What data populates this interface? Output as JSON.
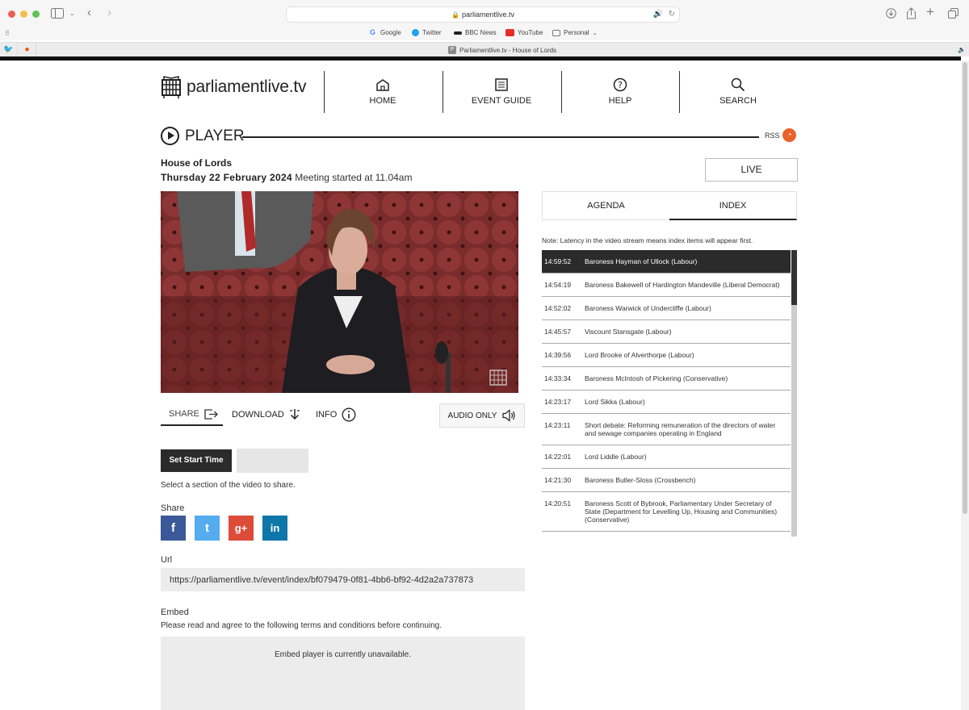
{
  "browser": {
    "url": "parliamentlive.tv",
    "favorites": [
      "Google",
      "Twitter",
      "BBC News",
      "YouTube",
      "Personal"
    ],
    "tab_title": "Parliamentlive.tv - House of Lords",
    "tab_badge": "P"
  },
  "site": {
    "logo": "parliamentlive.tv",
    "nav": [
      "HOME",
      "EVENT GUIDE",
      "HELP",
      "SEARCH"
    ]
  },
  "player": {
    "heading": "PLAYER",
    "rss": "RSS",
    "house": "House of Lords",
    "date": "Thursday 22 February 2024",
    "meeting": "Meeting started at 11.04am",
    "live_button": "LIVE",
    "toolbar": {
      "share": "SHARE",
      "download": "DOWNLOAD",
      "info": "INFO",
      "audio_only": "AUDIO ONLY"
    },
    "set_start_time": "Set Start Time",
    "select_text": "Select a section of the video to share.",
    "share_label": "Share",
    "social": [
      "f",
      "t",
      "g+",
      "in"
    ],
    "url_label": "Url",
    "url_value": "https://parliamentlive.tv/event/index/bf079479-0f81-4bb6-bf92-4d2a2a737873",
    "embed_label": "Embed",
    "embed_text": "Please read and agree to the following terms and conditions before continuing.",
    "embed_unavailable": "Embed player is currently unavailable."
  },
  "panel": {
    "tabs": [
      "AGENDA",
      "INDEX"
    ],
    "note": "Note:  Latency in the video stream means index items will appear first.",
    "index": [
      {
        "time": "14:59:52",
        "name": "Baroness Hayman of Ullock (Labour)"
      },
      {
        "time": "14:54:19",
        "name": "Baroness Bakewell of Hardington Mandeville (Liberal Democrat)"
      },
      {
        "time": "14:52:02",
        "name": "Baroness Warwick of Undercliffe (Labour)"
      },
      {
        "time": "14:45:57",
        "name": "Viscount Stansgate (Labour)"
      },
      {
        "time": "14:39:56",
        "name": "Lord Brooke of Alverthorpe (Labour)"
      },
      {
        "time": "14:33:34",
        "name": "Baroness McIntosh of Pickering (Conservative)"
      },
      {
        "time": "14:23:17",
        "name": "Lord Sikka (Labour)"
      },
      {
        "time": "14:23:11",
        "name": "Short debate: Reforming remuneration of the directors of water and sewage companies operating in England"
      },
      {
        "time": "14:22:01",
        "name": "Lord Liddle (Labour)"
      },
      {
        "time": "14:21:30",
        "name": "Baroness Butler-Sloss (Crossbench)"
      },
      {
        "time": "14:20:51",
        "name": "Baroness Scott of Bybrook, Parliamentary Under Secretary of State (Department for Levelling Up, Housing and Communities) (Conservative)"
      }
    ]
  },
  "colors": {
    "active_row": "#2b2b2b",
    "facebook": "#3b5998",
    "twitter": "#55acee",
    "google_plus": "#dd4b39",
    "linkedin": "#0e76a8",
    "rss": "#e8622a"
  }
}
